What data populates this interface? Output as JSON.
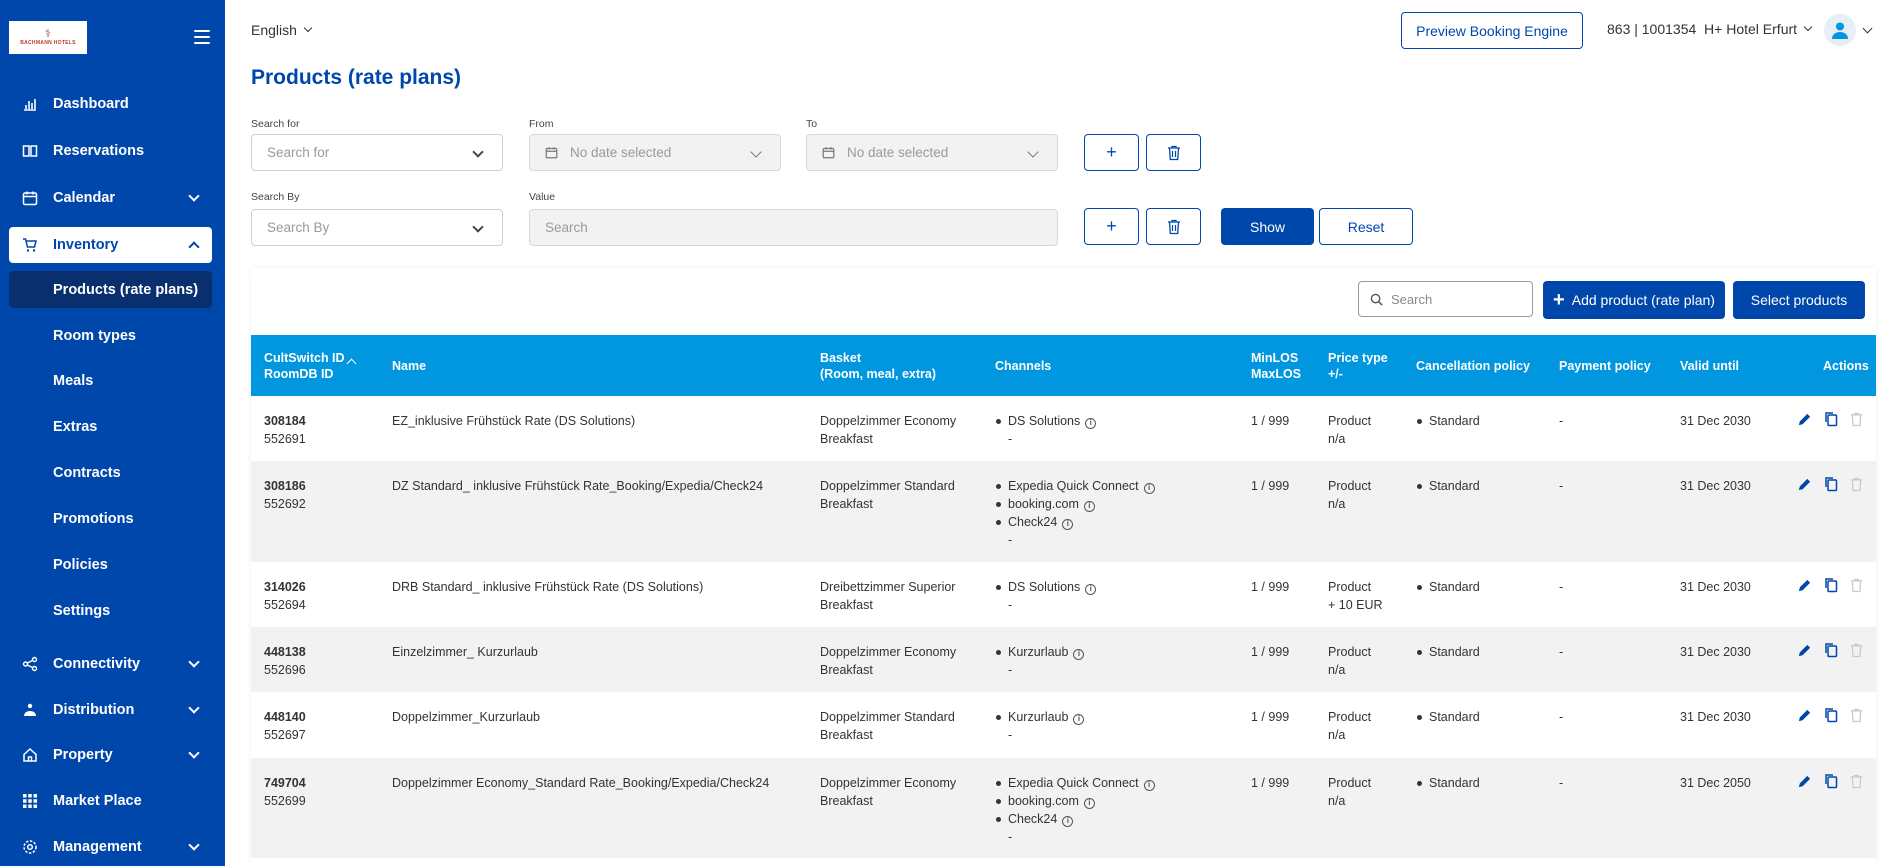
{
  "logo": {
    "text": "BACHMANN HOTELS",
    "mark": "⚕"
  },
  "sidebar": {
    "items": [
      {
        "label": "Dashboard",
        "icon": "chart-bar-icon"
      },
      {
        "label": "Reservations",
        "icon": "book-icon"
      },
      {
        "label": "Calendar",
        "icon": "calendar-icon"
      },
      {
        "label": "Inventory",
        "icon": "cart-icon"
      },
      {
        "label": "Connectivity",
        "icon": "share-icon"
      },
      {
        "label": "Distribution",
        "icon": "distribution-icon"
      },
      {
        "label": "Property",
        "icon": "home-icon"
      },
      {
        "label": "Market Place",
        "icon": "grid-icon"
      },
      {
        "label": "Management",
        "icon": "gear-icon"
      }
    ],
    "inventory_sub": [
      "Products (rate plans)",
      "Room types",
      "Meals",
      "Extras",
      "Contracts",
      "Promotions",
      "Policies",
      "Settings"
    ]
  },
  "topbar": {
    "language": "English",
    "preview_label": "Preview Booking Engine",
    "hotel": "863 | 1001354  H+ Hotel Erfurt"
  },
  "page": {
    "title": "Products (rate plans)"
  },
  "filters": {
    "search_for_label": "Search for",
    "search_for_placeholder": "Search for",
    "from_label": "From",
    "from_placeholder": "No date selected",
    "to_label": "To",
    "to_placeholder": "No date selected",
    "search_by_label": "Search By",
    "search_by_placeholder": "Search By",
    "value_label": "Value",
    "value_placeholder": "Search",
    "plus": "+",
    "show_label": "Show",
    "reset_label": "Reset"
  },
  "table_tools": {
    "search_placeholder": "Search",
    "add_label": "Add product (rate plan)",
    "select_label": "Select products"
  },
  "table": {
    "headers": {
      "id1": "CultSwitch ID",
      "id2": "RoomDB ID",
      "name": "Name",
      "basket1": "Basket",
      "basket2": "(Room, meal, extra)",
      "channels": "Channels",
      "los1": "MinLOS",
      "los2": "MaxLOS",
      "price1": "Price type",
      "price2": "+/-",
      "cancel": "Cancellation policy",
      "payment": "Payment policy",
      "valid": "Valid until",
      "actions": "Actions"
    },
    "rows": [
      {
        "cs_id": "308184",
        "room_id": "552691",
        "name": "EZ_inklusive Frühstück Rate (DS Solutions)",
        "room": "Doppelzimmer Economy",
        "meal": "Breakfast",
        "channels": [
          "DS Solutions"
        ],
        "channels_extra": "-",
        "los": "1 / 999",
        "price_type": "Product",
        "price_diff": "n/a",
        "cancel": "Standard",
        "payment": "-",
        "valid": "31 Dec 2030"
      },
      {
        "cs_id": "308186",
        "room_id": "552692",
        "name": "DZ Standard_ inklusive Frühstück Rate_Booking/Expedia/Check24",
        "room": "Doppelzimmer Standard",
        "meal": "Breakfast",
        "channels": [
          "Expedia Quick Connect",
          "booking.com",
          "Check24"
        ],
        "channels_extra": "-",
        "los": "1 / 999",
        "price_type": "Product",
        "price_diff": "n/a",
        "cancel": "Standard",
        "payment": "-",
        "valid": "31 Dec 2030"
      },
      {
        "cs_id": "314026",
        "room_id": "552694",
        "name": "DRB Standard_ inklusive Frühstück Rate (DS Solutions)",
        "room": "Dreibettzimmer Superior",
        "meal": "Breakfast",
        "channels": [
          "DS Solutions"
        ],
        "channels_extra": "-",
        "los": "1 / 999",
        "price_type": "Product",
        "price_diff": "+ 10 EUR",
        "cancel": "Standard",
        "payment": "-",
        "valid": "31 Dec 2030"
      },
      {
        "cs_id": "448138",
        "room_id": "552696",
        "name": "Einzelzimmer_ Kurzurlaub",
        "room": "Doppelzimmer Economy",
        "meal": "Breakfast",
        "channels": [
          "Kurzurlaub"
        ],
        "channels_extra": "-",
        "los": "1 / 999",
        "price_type": "Product",
        "price_diff": "n/a",
        "cancel": "Standard",
        "payment": "-",
        "valid": "31 Dec 2030"
      },
      {
        "cs_id": "448140",
        "room_id": "552697",
        "name": "Doppelzimmer_Kurzurlaub",
        "room": "Doppelzimmer Standard",
        "meal": "Breakfast",
        "channels": [
          "Kurzurlaub"
        ],
        "channels_extra": "-",
        "los": "1 / 999",
        "price_type": "Product",
        "price_diff": "n/a",
        "cancel": "Standard",
        "payment": "-",
        "valid": "31 Dec 2030"
      },
      {
        "cs_id": "749704",
        "room_id": "552699",
        "name": "Doppelzimmer Economy_Standard Rate_Booking/Expedia/Check24",
        "room": "Doppelzimmer Economy",
        "meal": "Breakfast",
        "channels": [
          "Expedia Quick Connect",
          "booking.com",
          "Check24"
        ],
        "channels_extra": "-",
        "los": "1 / 999",
        "price_type": "Product",
        "price_diff": "n/a",
        "cancel": "Standard",
        "payment": "-",
        "valid": "31 Dec 2050"
      }
    ]
  },
  "colors": {
    "brand": "#0047ab",
    "header": "#0096e0",
    "sub_active": "#0a2f6e"
  }
}
